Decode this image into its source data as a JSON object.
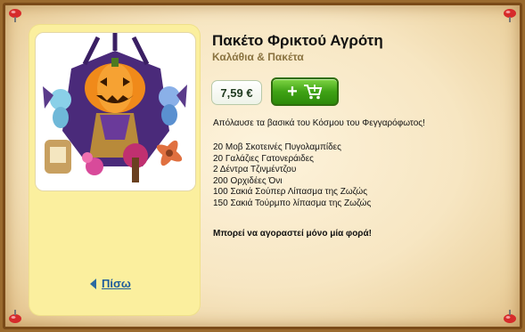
{
  "product": {
    "title": "Πακέτο Φρικτού Αγρότη",
    "category": "Καλάθια & Πακέτα",
    "price": "7,59 €",
    "description": "Απόλαυσε τα βασικά του Κόσμου του Φεγγαρόφωτος!",
    "items": [
      "20 Μοβ Σκοτεινές Πυγολαμπίδες",
      "20 Γαλάζιες Γατονεράιδες",
      "2 Δέντρα Τζινμέντζου",
      "200 Ορχιδέες Όνι",
      "100 Σακιά Σούπερ Λίπασμα της Ζωζώς",
      "150 Σακιά Τούρμπο λίπασμα της Ζωζώς"
    ],
    "note": "Μπορεί να αγοραστεί μόνο μία φορά!"
  },
  "nav": {
    "back_label": "Πίσω"
  },
  "icons": {
    "buy": "add-to-cart-icon",
    "back": "back-arrow-icon",
    "pins": "pushpin-icon"
  },
  "colors": {
    "buy_button": "#3fa215",
    "panel": "#fbef9e",
    "link": "#1d5c9b"
  }
}
